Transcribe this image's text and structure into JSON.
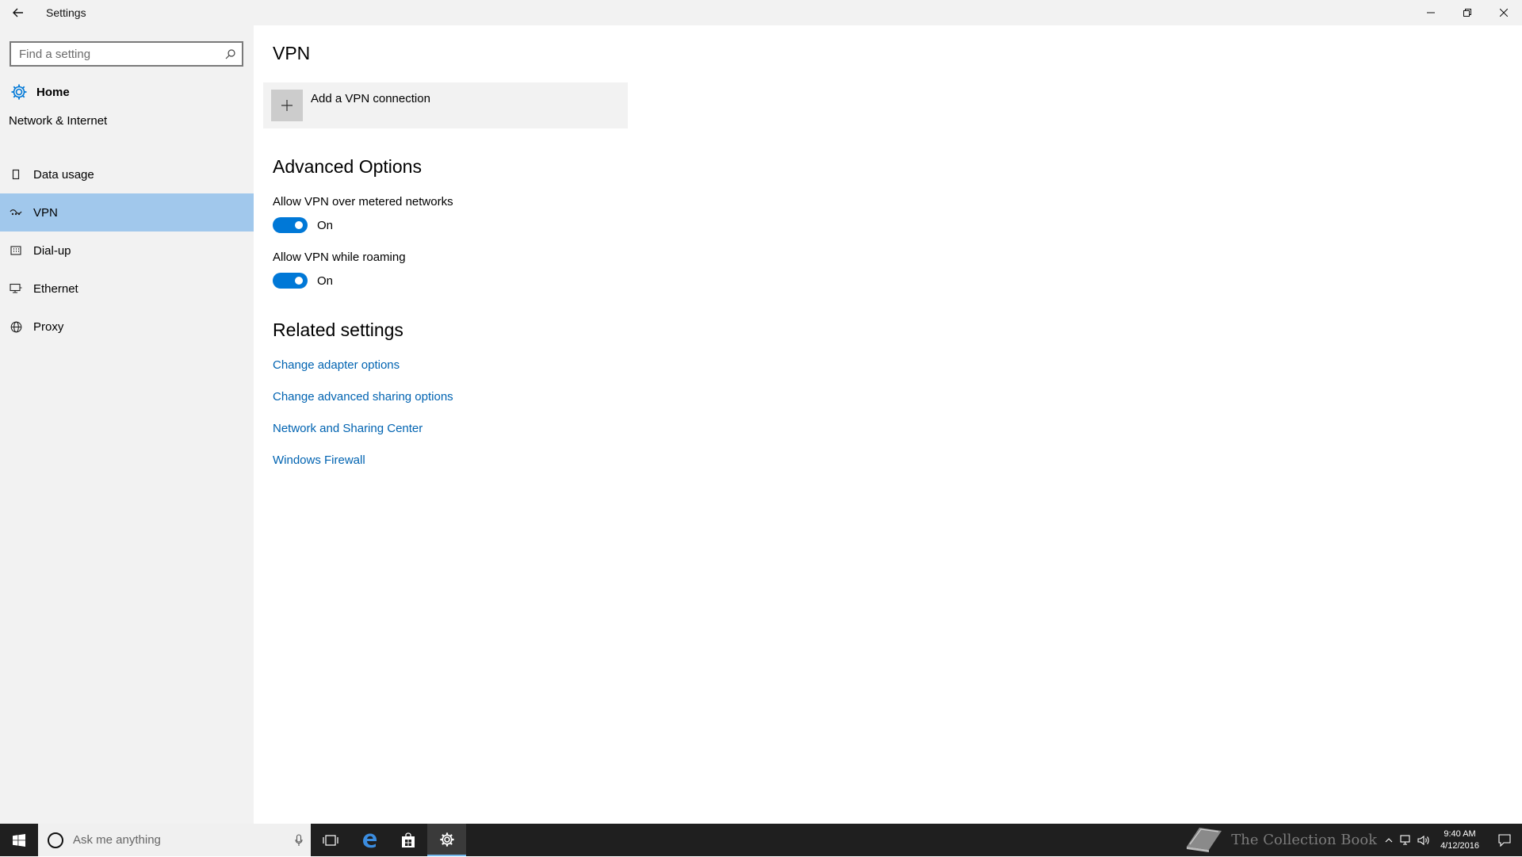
{
  "window": {
    "title": "Settings",
    "back_icon": "back-arrow-icon",
    "controls": {
      "minimize": "—",
      "restore": "❐",
      "close": "✕"
    }
  },
  "sidebar": {
    "search_placeholder": "Find a setting",
    "home_label": "Home",
    "section_title": "Network & Internet",
    "items": [
      {
        "label": "Data usage",
        "icon": "data-usage-icon",
        "active": false
      },
      {
        "label": "VPN",
        "icon": "vpn-icon",
        "active": true
      },
      {
        "label": "Dial-up",
        "icon": "dialup-icon",
        "active": false
      },
      {
        "label": "Ethernet",
        "icon": "ethernet-icon",
        "active": false
      },
      {
        "label": "Proxy",
        "icon": "globe-icon",
        "active": false
      }
    ]
  },
  "main": {
    "title": "VPN",
    "add_vpn_label": "Add a VPN connection",
    "advanced_title": "Advanced Options",
    "options": [
      {
        "label": "Allow VPN over metered networks",
        "state": "On"
      },
      {
        "label": "Allow VPN while roaming",
        "state": "On"
      }
    ],
    "related_title": "Related settings",
    "links": [
      "Change adapter options",
      "Change advanced sharing options",
      "Network and Sharing Center",
      "Windows Firewall"
    ]
  },
  "taskbar": {
    "cortana_placeholder": "Ask me anything",
    "time": "9:40 AM",
    "date": "4/12/2016",
    "watermark": "The Collection Book"
  },
  "colors": {
    "accent": "#0078d7",
    "link": "#0063b1",
    "nav_active": "#a1c8ec",
    "sidebar_bg": "#f2f2f2",
    "taskbar_bg": "#1f1f1f"
  }
}
